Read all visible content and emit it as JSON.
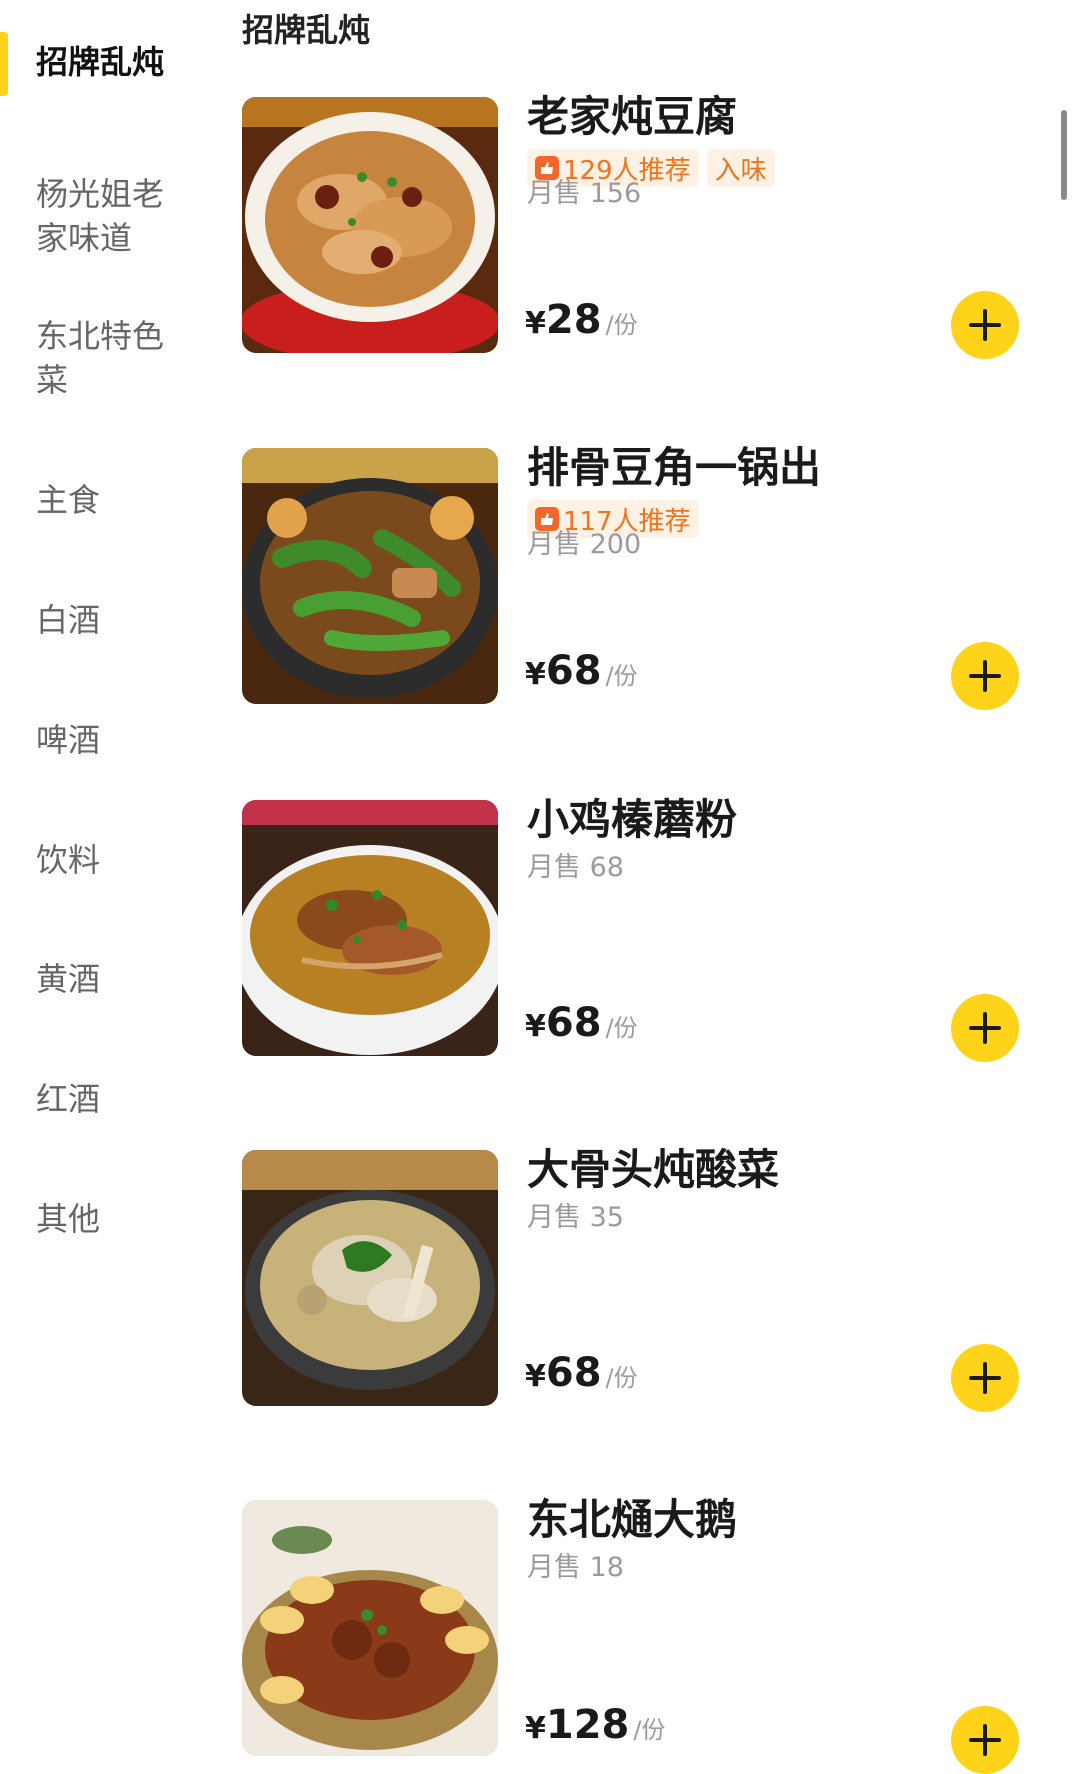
{
  "categories": [
    {
      "label": "招牌乱炖",
      "active": true
    },
    {
      "label": "杨光姐老"
    },
    {
      "label": "家味道"
    },
    {
      "label": "东北特色"
    },
    {
      "label": "菜"
    },
    {
      "label": "主食"
    },
    {
      "label": "白酒"
    },
    {
      "label": "啤酒"
    },
    {
      "label": "饮料"
    },
    {
      "label": "黄酒"
    },
    {
      "label": "红酒"
    },
    {
      "label": "其他"
    }
  ],
  "section_title": "招牌乱炖",
  "dishes": [
    {
      "name": "老家炖豆腐",
      "recommend": "129人推荐",
      "tag": "入味",
      "monthly": "月售 156",
      "currency": "¥",
      "price": "28",
      "unit": "/份",
      "image_icon": "braised-tofu-dish-photo"
    },
    {
      "name": "排骨豆角一锅出",
      "recommend": "117人推荐",
      "monthly": "月售 200",
      "currency": "¥",
      "price": "68",
      "unit": "/份",
      "image_icon": "ribs-green-beans-dish-photo"
    },
    {
      "name": "小鸡榛蘑粉",
      "monthly": "月售 68",
      "currency": "¥",
      "price": "68",
      "unit": "/份",
      "image_icon": "chicken-mushroom-soup-photo"
    },
    {
      "name": "大骨头炖酸菜",
      "monthly": "月售 35",
      "currency": "¥",
      "price": "68",
      "unit": "/份",
      "image_icon": "pork-bone-sauerkraut-photo"
    },
    {
      "name": "东北熥大鹅",
      "monthly": "月售 18",
      "currency": "¥",
      "price": "128",
      "unit": "/份",
      "image_icon": "stewed-goose-dish-photo"
    }
  ],
  "colors": {
    "accent_yellow": "#ffd31a",
    "tag_orange": "#f0731e",
    "tag_bg": "#fff1e4",
    "muted_text": "#9b9b9b"
  }
}
